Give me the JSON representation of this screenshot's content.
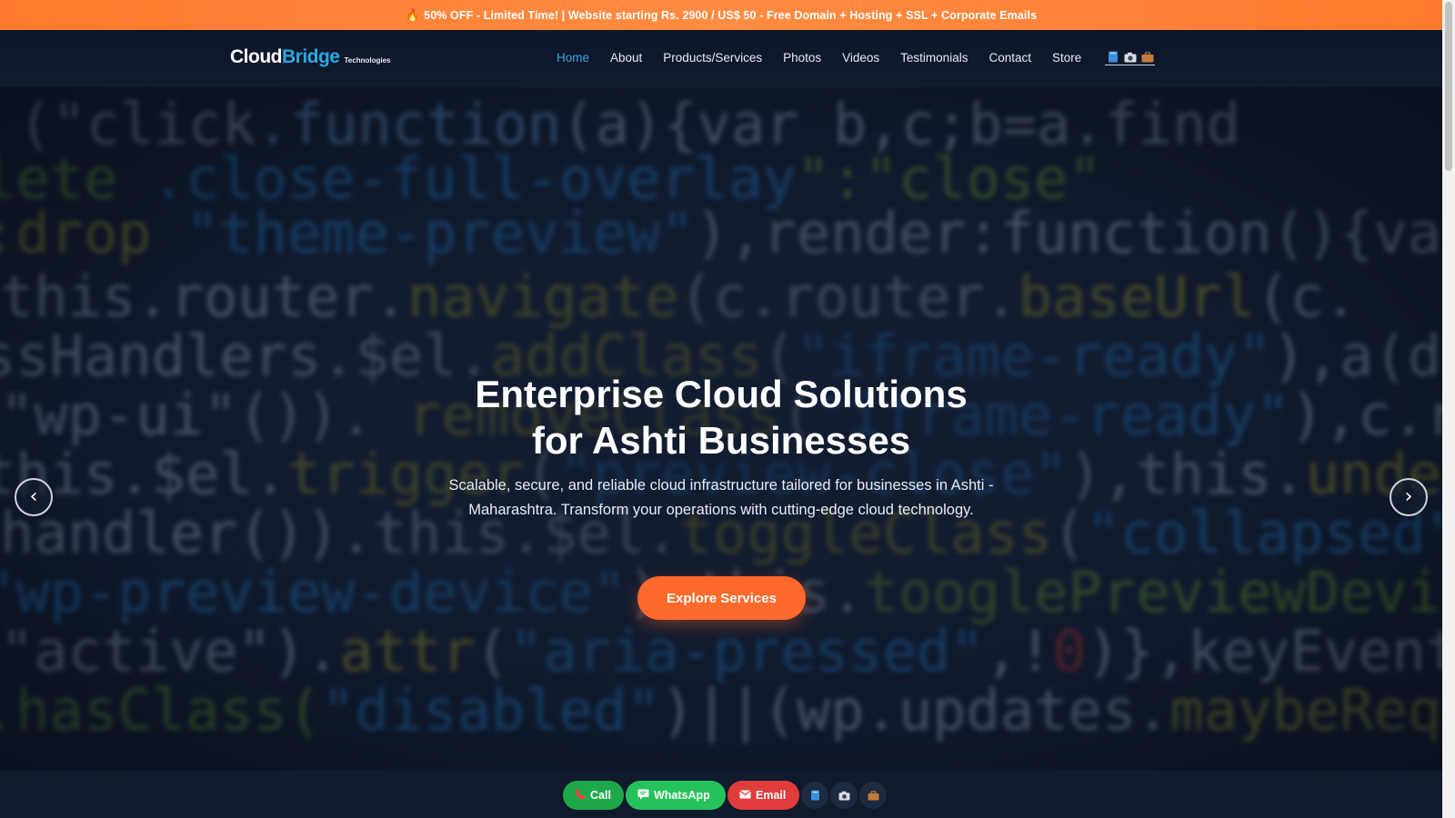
{
  "promo": {
    "text": "50% OFF - Limited Time! | Website starting Rs. 2900 / US$ 50 - Free Domain + Hosting + SSL + Corporate Emails",
    "icon": "flame-icon"
  },
  "logo": {
    "part1": "Cloud",
    "part2": "Bridge",
    "suffix": "Technologies"
  },
  "nav": {
    "items": [
      {
        "label": "Home",
        "active": true
      },
      {
        "label": "About"
      },
      {
        "label": "Products/Services"
      },
      {
        "label": "Photos"
      },
      {
        "label": "Videos"
      },
      {
        "label": "Testimonials"
      },
      {
        "label": "Contact"
      },
      {
        "label": "Store"
      }
    ],
    "icons": [
      "book-icon",
      "camera-icon",
      "briefcase-icon"
    ]
  },
  "hero": {
    "title_line1": "Enterprise Cloud Solutions",
    "title_line2": "for Ashti Businesses",
    "subtitle": "Scalable, secure, and reliable cloud infrastructure tailored for businesses in Ashti - Maharashtra. Transform your operations with cutting-edge cloud technology.",
    "cta_label": "Explore Services",
    "prev_label": "‹",
    "next_label": "›"
  },
  "actions": {
    "call": "Call",
    "whatsapp": "WhatsApp",
    "email": "Email",
    "icons": [
      "book-icon",
      "camera-icon",
      "briefcase-icon"
    ]
  },
  "colors": {
    "accent_orange": "#ff6a2c",
    "nav_active": "#3aa8e8",
    "brand_blue": "#2aa8e0",
    "call_green": "#1fa84a",
    "whatsapp_green": "#25c25c",
    "email_red": "#e03c3c"
  }
}
